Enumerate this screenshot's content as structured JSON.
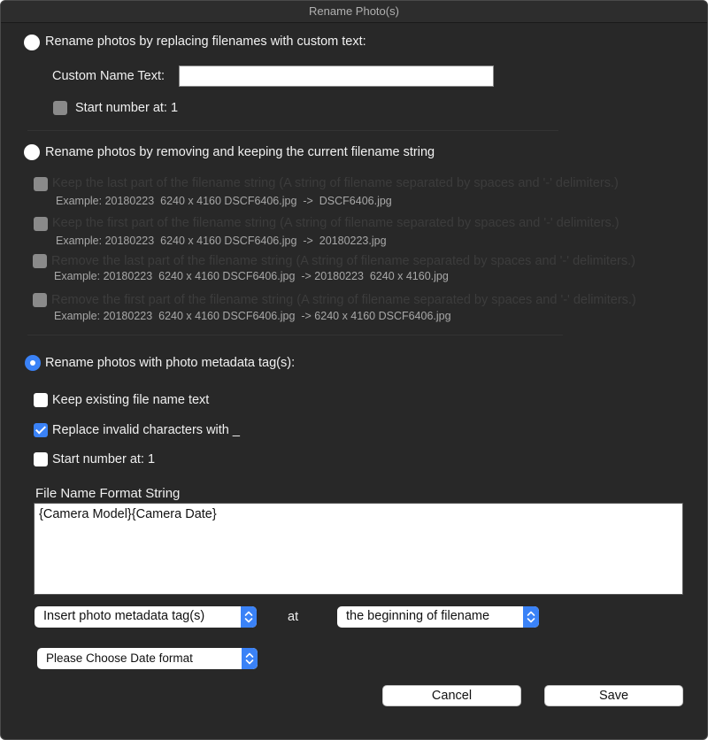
{
  "window": {
    "title": "Rename Photo(s)"
  },
  "section_custom": {
    "radio_label": "Rename photos by replacing filenames with custom text:",
    "selected": false,
    "custom_name_label": "Custom Name Text:",
    "custom_name_value": "",
    "start_number_label": "Start number at: 1",
    "start_number_checked": false
  },
  "section_remove_keep": {
    "radio_label": "Rename photos by removing and keeping the current filename string",
    "selected": false,
    "options": [
      {
        "label": "Keep the last part of the filename string (A string of filename separated by spaces and '-' delimiters.)",
        "example": "Example: 20180223  6240 x 4160 DSCF6406.jpg  ->  DSCF6406.jpg",
        "checked": false
      },
      {
        "label": "Keep the first part of the filename string (A string of filename separated by spaces and '-' delimiters.)",
        "example": "Example: 20180223  6240 x 4160 DSCF6406.jpg  ->  20180223.jpg",
        "checked": false
      },
      {
        "label": "Remove the last part of the filename string (A string of filename separated by spaces and '-' delimiters.)",
        "example": "Example: 20180223  6240 x 4160 DSCF6406.jpg  -> 20180223  6240 x 4160.jpg",
        "checked": false
      },
      {
        "label": "Remove the first part of the filename string (A string of filename separated by spaces and '-' delimiters.)",
        "example": "Example: 20180223  6240 x 4160 DSCF6406.jpg  -> 6240 x 4160 DSCF6406.jpg",
        "checked": false
      }
    ]
  },
  "section_metadata": {
    "radio_label": "Rename photos with photo metadata tag(s):",
    "selected": true,
    "keep_existing_label": "Keep existing file name text",
    "keep_existing_checked": false,
    "replace_invalid_label": "Replace invalid characters with _",
    "replace_invalid_checked": true,
    "start_number_label": "Start number at: 1",
    "start_number_checked": false,
    "format_string_label": "File Name Format String",
    "format_string_value": "{Camera Model}{Camera Date}",
    "insert_tag_popup": "Insert photo metadata tag(s)",
    "at_label": "at",
    "position_popup": "the beginning of filename",
    "date_format_popup": "Please Choose Date format"
  },
  "buttons": {
    "cancel": "Cancel",
    "save": "Save"
  },
  "colors": {
    "accent": "#3a82f7",
    "background": "#282828"
  }
}
